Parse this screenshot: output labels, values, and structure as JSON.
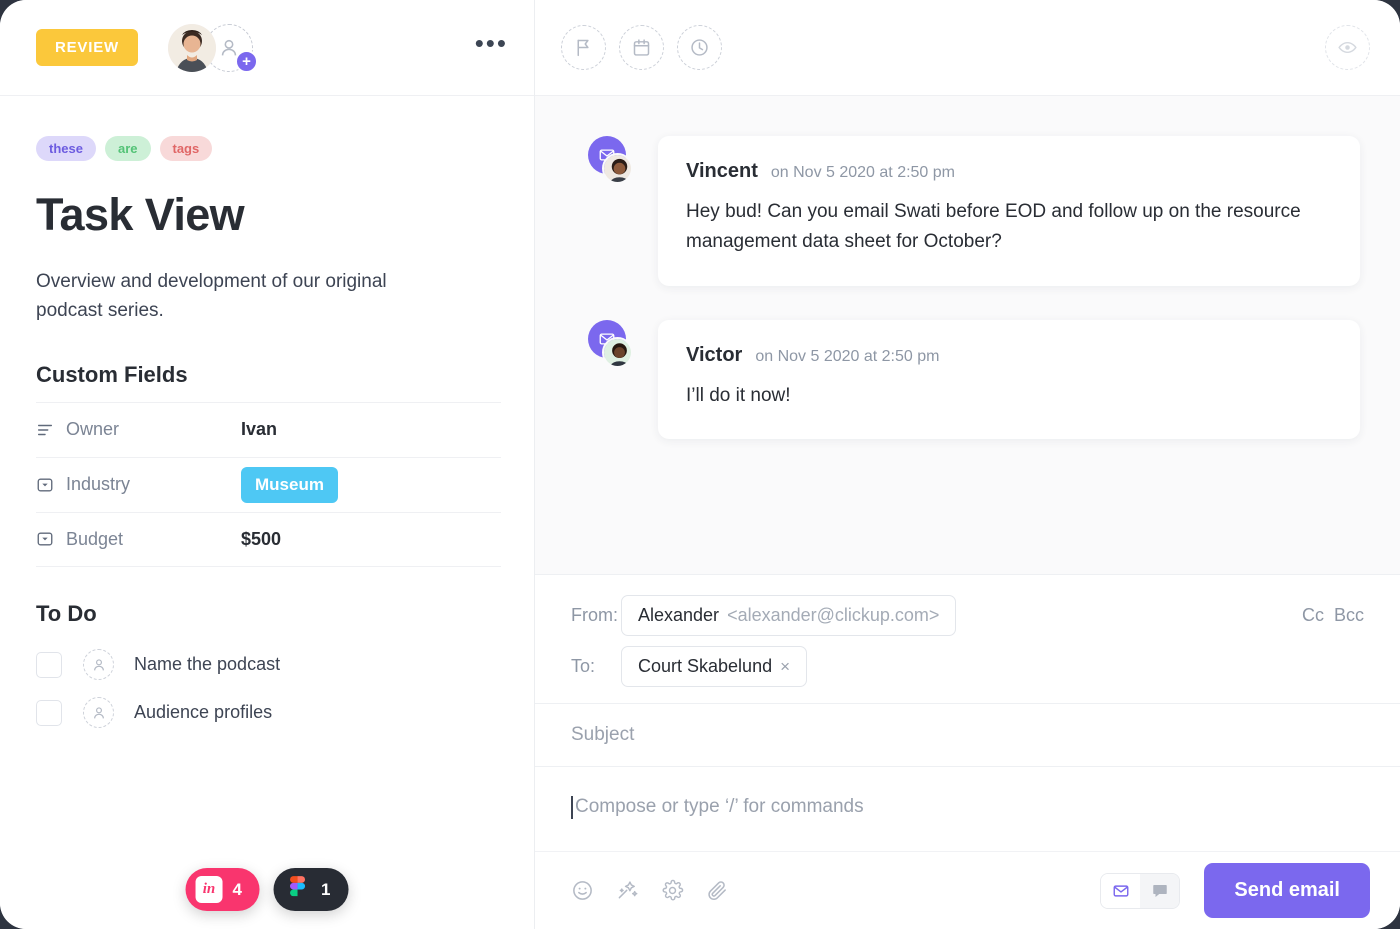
{
  "colors": {
    "accent_purple": "#7b68ee",
    "status_yellow": "#fbc83b",
    "badge_blue": "#4ec8f4",
    "invision_pink": "#f9356e",
    "figma_dark": "#282c34",
    "page_background": "#2e3440"
  },
  "task_header": {
    "status_label": "REVIEW",
    "assignee_avatar_name": "avatar-ivan",
    "add_assignee_label": "+",
    "more_options_label": "•••"
  },
  "task_toolbar": {
    "icons": [
      {
        "name": "flag-icon",
        "label": "Priority"
      },
      {
        "name": "calendar-icon",
        "label": "Due date"
      },
      {
        "name": "clock-icon",
        "label": "Time estimate"
      }
    ],
    "watch_icon": {
      "name": "eye-icon",
      "label": "Watch"
    }
  },
  "task": {
    "tags": [
      {
        "label": "these",
        "color": "purple"
      },
      {
        "label": "are",
        "color": "green"
      },
      {
        "label": "tags",
        "color": "red"
      }
    ],
    "title": "Task View",
    "description": "Overview and development of our original podcast series."
  },
  "custom_fields": {
    "heading": "Custom Fields",
    "rows": [
      {
        "icon": "text-lines-icon",
        "label": "Owner",
        "value": "Ivan",
        "style": "text"
      },
      {
        "icon": "dropdown-icon",
        "label": "Industry",
        "value": "Museum",
        "style": "badge"
      },
      {
        "icon": "dropdown-icon",
        "label": "Budget",
        "value": "$500",
        "style": "text"
      }
    ]
  },
  "todo": {
    "heading": "To Do",
    "items": [
      {
        "label": "Name the podcast",
        "checked": false
      },
      {
        "label": "Audience profiles",
        "checked": false
      }
    ]
  },
  "integrations": [
    {
      "name": "invision",
      "logo_text": "in",
      "count": "4"
    },
    {
      "name": "figma",
      "logo_text": "",
      "count": "1"
    }
  ],
  "comments": [
    {
      "author": "Vincent",
      "time": "on Nov 5 2020 at 2:50 pm",
      "text": "Hey bud! Can you email Swati before EOD and follow up on the resource management data sheet for October?",
      "channel_icon": "email-icon"
    },
    {
      "author": "Victor",
      "time": "on Nov 5 2020 at 2:50 pm",
      "text": "I’ll do it now!",
      "channel_icon": "email-icon"
    }
  ],
  "compose": {
    "from_label": "From:",
    "from_name": "Alexander",
    "from_email": "<alexander@clickup.com>",
    "to_label": "To:",
    "to_chip": "Court Skabelund",
    "to_chip_remove": "×",
    "cc_label": "Cc",
    "bcc_label": "Bcc",
    "subject_placeholder": "Subject",
    "body_placeholder": "Compose or type ‘/’ for commands",
    "toolbar_icons": [
      {
        "name": "emoji-icon"
      },
      {
        "name": "magic-wand-icon"
      },
      {
        "name": "gear-icon"
      },
      {
        "name": "attachment-icon"
      }
    ],
    "mode_toggle": [
      {
        "name": "email-mode",
        "active": true
      },
      {
        "name": "comment-mode",
        "active": false
      }
    ],
    "send_label": "Send email"
  }
}
